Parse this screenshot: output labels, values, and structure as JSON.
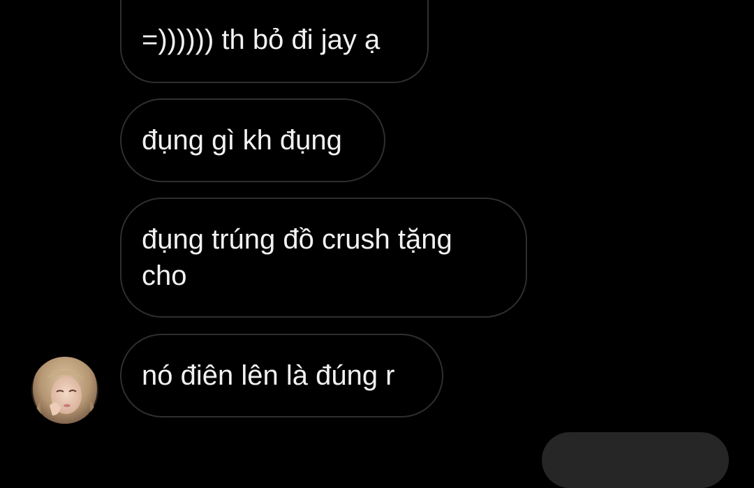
{
  "thread": {
    "messages": [
      {
        "text": "=)))))) th bỏ đi jay ạ"
      },
      {
        "text": "đụng gì kh đụng"
      },
      {
        "text": "đụng trúng đồ crush tặng\ncho"
      },
      {
        "text": "nó điên lên là đúng r"
      }
    ],
    "avatar_icon": "user-avatar-icon",
    "colors": {
      "background": "#000000",
      "bubble_border": "#2f2f2f",
      "text": "#f2f2f2",
      "outgoing_bubble": "#262626"
    }
  }
}
